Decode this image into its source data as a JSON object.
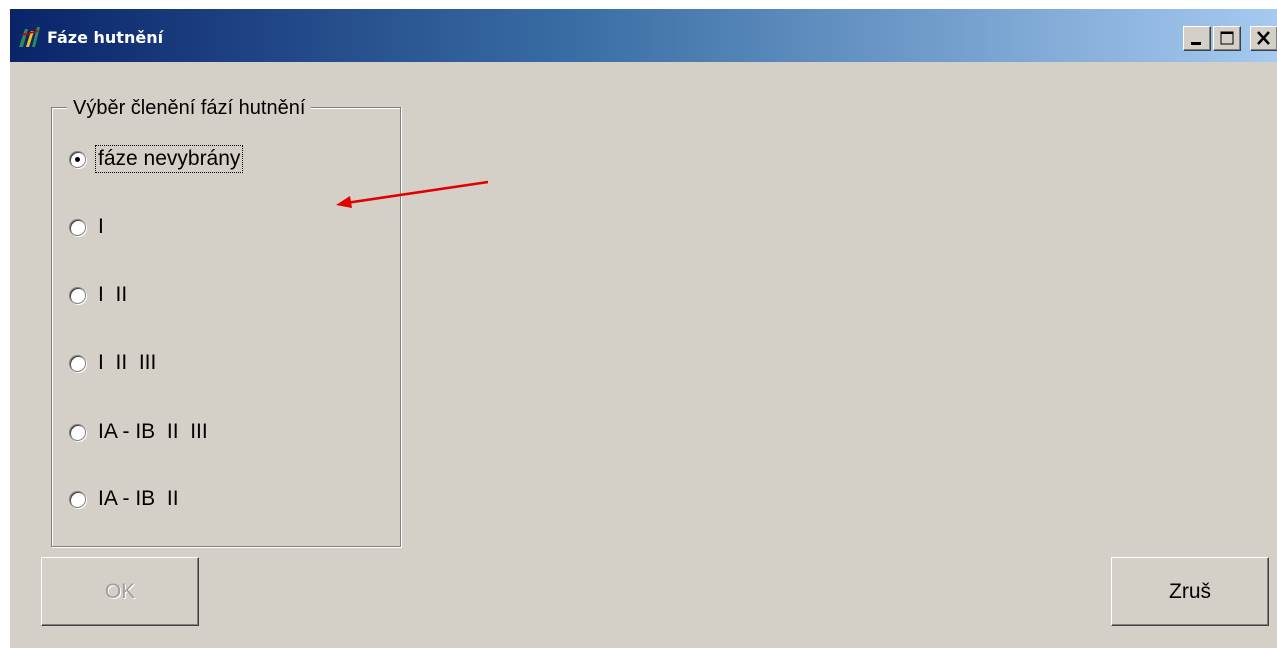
{
  "window": {
    "title": "Fáze hutnění",
    "controls": {
      "minimize_icon": "minimize-icon",
      "maximize_icon": "maximize-icon",
      "close_icon": "close-icon"
    }
  },
  "group": {
    "legend": "Výběr členění fází hutnění",
    "options": [
      {
        "label": "fáze nevybrány",
        "selected": true
      },
      {
        "label": "I",
        "selected": false
      },
      {
        "label": "I  II",
        "selected": false
      },
      {
        "label": "I  II  III",
        "selected": false
      },
      {
        "label": "IA - IB  II  III",
        "selected": false
      },
      {
        "label": "IA - IB  II",
        "selected": false
      }
    ]
  },
  "buttons": {
    "ok_label": "OK",
    "ok_enabled": false,
    "cancel_label": "Zruš"
  },
  "colors": {
    "titlebar_start": "#0a246a",
    "titlebar_end": "#a6caf0",
    "dialog_bg": "#d4d0c8",
    "annotation_arrow": "#e00000"
  }
}
